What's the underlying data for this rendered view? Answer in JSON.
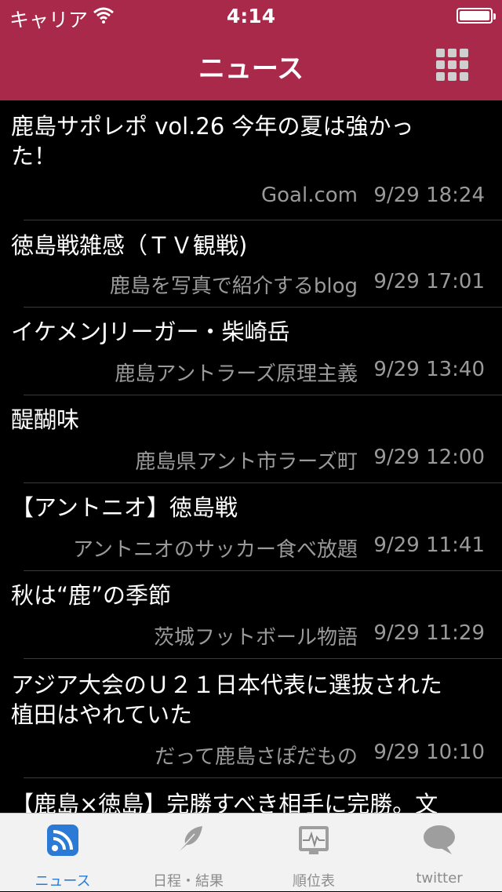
{
  "status_bar": {
    "carrier": "キャリア",
    "time": "4:14"
  },
  "nav": {
    "title": "ニュース",
    "menu_icon": "grid-icon"
  },
  "news": [
    {
      "title": "鹿島サポレポ vol.26 今年の夏は強かっ",
      "title2": "た！",
      "source": "Goal.com",
      "time": "9/29 18:24"
    },
    {
      "title": "徳島戦雑感（ＴＶ観戦)",
      "source": "鹿島を写真で紹介するblog",
      "time": "9/29 17:01"
    },
    {
      "title": "イケメンJリーガー・柴崎岳",
      "source": "鹿島アントラーズ原理主義",
      "time": "9/29 13:40"
    },
    {
      "title": "醍醐味",
      "source": "鹿島県アント市ラーズ町",
      "time": "9/29 12:00"
    },
    {
      "title": "【アントニオ】徳島戦",
      "source": "アントニオのサッカー食べ放題",
      "time": "9/29 11:41"
    },
    {
      "title": "秋は“鹿”の季節",
      "source": "茨城フットボール物語",
      "time": "9/29 11:29"
    },
    {
      "title": "アジア大会のＵ２１日本代表に選抜された",
      "title2": "植田はやれていた",
      "source": "だって鹿島さぽだもの",
      "time": "9/29 10:10"
    },
    {
      "title": "【鹿島×徳島】完勝すべき相手に完勝。文"
    }
  ],
  "tabs": [
    {
      "label": "ニュース",
      "icon": "rss-icon",
      "active": true
    },
    {
      "label": "日程・結果",
      "icon": "feather-icon",
      "active": false
    },
    {
      "label": "順位表",
      "icon": "chart-monitor-icon",
      "active": false
    },
    {
      "label": "twitter",
      "icon": "speech-bubble-icon",
      "active": false
    }
  ],
  "colors": {
    "header": "#a9294a",
    "tab_active": "#2a7ad6",
    "tab_inactive": "#8c8c8c"
  }
}
